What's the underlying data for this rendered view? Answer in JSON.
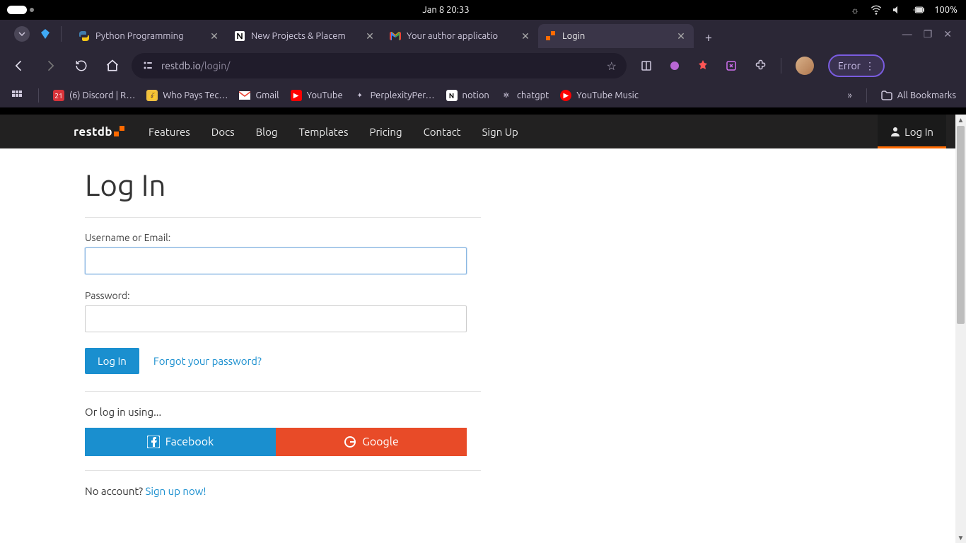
{
  "system": {
    "clock": "Jan 8  20:33",
    "battery": "100%"
  },
  "browser": {
    "tabs": [
      {
        "label": "Python Programming",
        "icon": "python"
      },
      {
        "label": "New Projects & Placem",
        "icon": "notion"
      },
      {
        "label": "Your author applicatio",
        "icon": "gmail"
      },
      {
        "label": "Login",
        "icon": "restdb"
      }
    ],
    "url_host": "restdb.io",
    "url_path": "/login/",
    "error_label": "Error",
    "bookmarks": [
      {
        "label": "(6) Discord | R…"
      },
      {
        "label": "Who Pays Tec…"
      },
      {
        "label": "Gmail"
      },
      {
        "label": "YouTube"
      },
      {
        "label": "PerplexityPer…"
      },
      {
        "label": "notion"
      },
      {
        "label": "chatgpt"
      },
      {
        "label": "YouTube Music"
      }
    ],
    "all_bookmarks": "All Bookmarks"
  },
  "site": {
    "brand": "restdb.io",
    "nav": [
      "Features",
      "Docs",
      "Blog",
      "Templates",
      "Pricing",
      "Contact",
      "Sign Up"
    ],
    "login": "Log In"
  },
  "page": {
    "heading": "Log In",
    "username_label": "Username or Email:",
    "password_label": "Password:",
    "login_btn": "Log In",
    "forgot": "Forgot your password?",
    "or": "Or log in using...",
    "fb": "Facebook",
    "google": "Google",
    "noacct": "No account? ",
    "signup": "Sign up now!"
  }
}
